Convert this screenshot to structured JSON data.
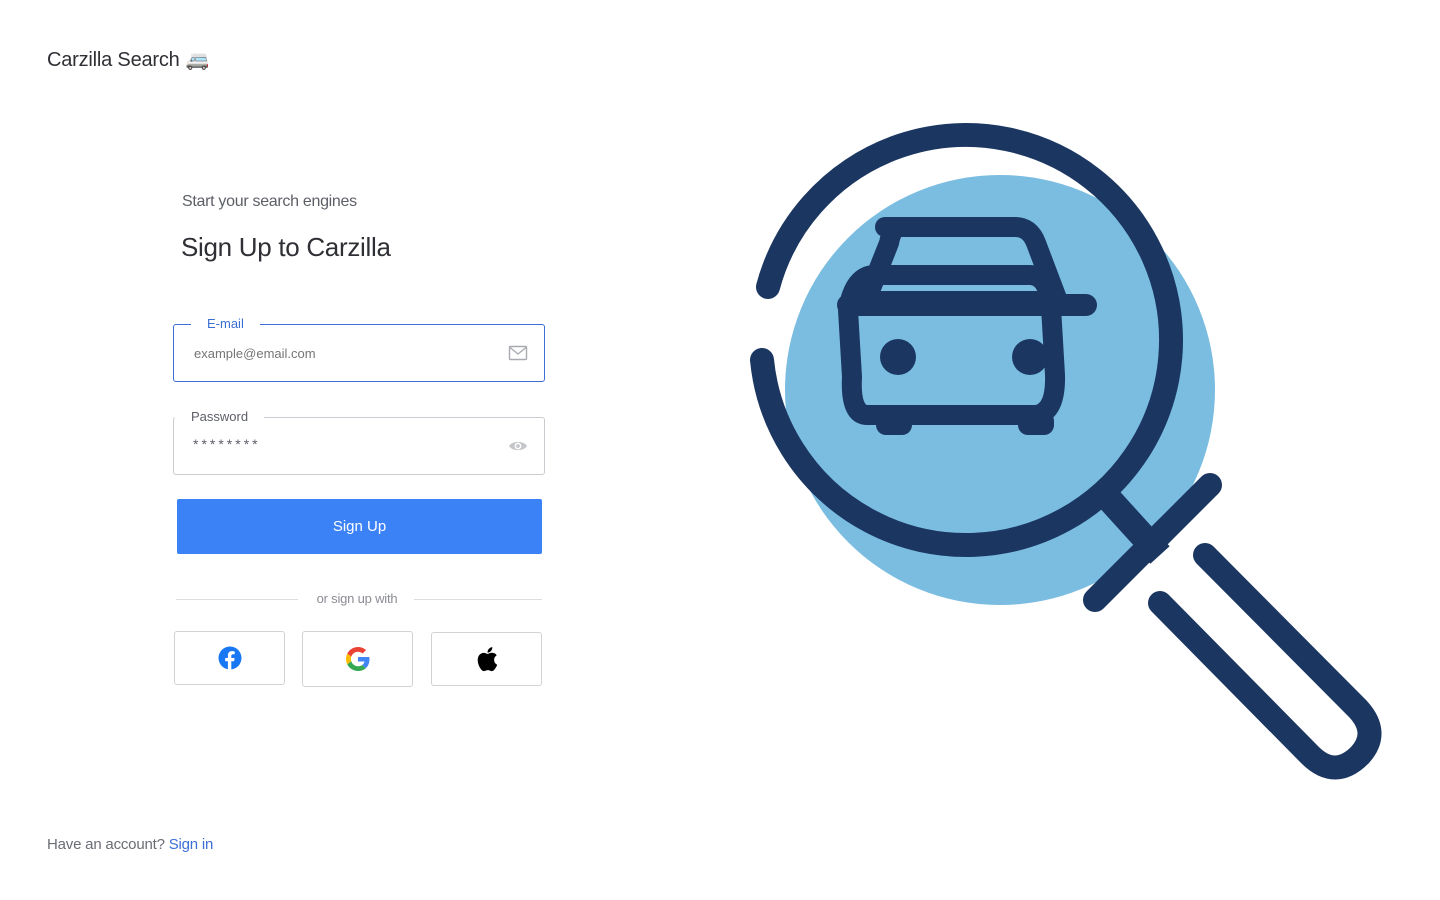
{
  "brand": {
    "name": "Carzilla Search",
    "emoji": "🚐"
  },
  "form": {
    "subtitle": "Start your search engines",
    "title": "Sign Up to Carzilla",
    "email": {
      "label": "E-mail",
      "placeholder": "example@email.com"
    },
    "password": {
      "label": "Password",
      "value": "********"
    },
    "submit_label": "Sign Up",
    "divider_text": "or sign up with",
    "social": [
      "facebook-icon",
      "google-icon",
      "apple-icon"
    ]
  },
  "footer": {
    "prompt": "Have an account?",
    "link_label": "Sign in"
  },
  "colors": {
    "accent": "#3b82f6",
    "link": "#3b6fd6",
    "illustration_dark": "#1b3761",
    "illustration_light": "#7bbde1"
  }
}
